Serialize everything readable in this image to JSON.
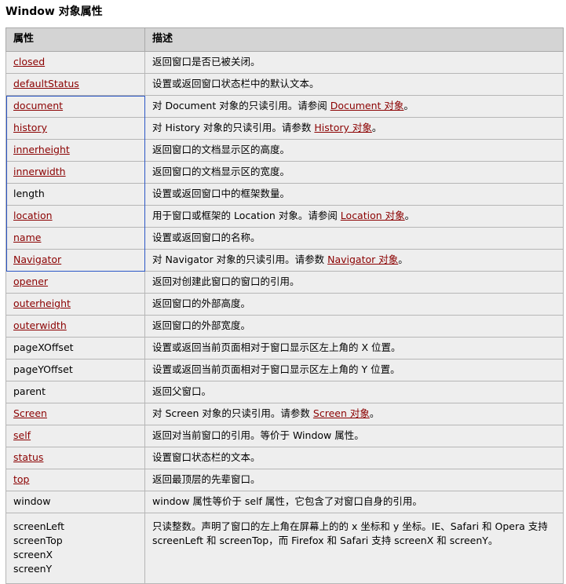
{
  "page": {
    "title": "Window 对象属性",
    "selection_color": "#2b56c6",
    "header_bg": "#d4d4d4",
    "row_bg": "#eeeeee",
    "link_color": "#8b0101"
  },
  "table": {
    "headers": {
      "property": "属性",
      "description": "描述"
    },
    "rows": [
      {
        "property": "closed",
        "property_is_link": true,
        "desc_parts": [
          {
            "text": "返回窗口是否已被关闭。",
            "link": false
          }
        ]
      },
      {
        "property": "defaultStatus",
        "property_is_link": true,
        "desc_parts": [
          {
            "text": "设置或返回窗口状态栏中的默认文本。",
            "link": false
          }
        ]
      },
      {
        "property": "document",
        "property_is_link": true,
        "desc_parts": [
          {
            "text": "对 Document 对象的只读引用。请参阅 ",
            "link": false
          },
          {
            "text": "Document 对象",
            "link": true
          },
          {
            "text": "。",
            "link": false
          }
        ]
      },
      {
        "property": "history",
        "property_is_link": true,
        "desc_parts": [
          {
            "text": "对 History 对象的只读引用。请参数 ",
            "link": false
          },
          {
            "text": "History 对象",
            "link": true
          },
          {
            "text": "。",
            "link": false
          }
        ]
      },
      {
        "property": "innerheight",
        "property_is_link": true,
        "desc_parts": [
          {
            "text": "返回窗口的文档显示区的高度。",
            "link": false
          }
        ]
      },
      {
        "property": "innerwidth",
        "property_is_link": true,
        "desc_parts": [
          {
            "text": "返回窗口的文档显示区的宽度。",
            "link": false
          }
        ]
      },
      {
        "property": "length",
        "property_is_link": false,
        "desc_parts": [
          {
            "text": "设置或返回窗口中的框架数量。",
            "link": false
          }
        ]
      },
      {
        "property": "location",
        "property_is_link": true,
        "desc_parts": [
          {
            "text": "用于窗口或框架的 Location 对象。请参阅 ",
            "link": false
          },
          {
            "text": "Location 对象",
            "link": true
          },
          {
            "text": "。",
            "link": false
          }
        ]
      },
      {
        "property": "name",
        "property_is_link": true,
        "desc_parts": [
          {
            "text": "设置或返回窗口的名称。",
            "link": false
          }
        ]
      },
      {
        "property": "Navigator",
        "property_is_link": true,
        "desc_parts": [
          {
            "text": "对 Navigator 对象的只读引用。请参数 ",
            "link": false
          },
          {
            "text": "Navigator 对象",
            "link": true
          },
          {
            "text": "。",
            "link": false
          }
        ]
      },
      {
        "property": "opener",
        "property_is_link": true,
        "desc_parts": [
          {
            "text": "返回对创建此窗口的窗口的引用。",
            "link": false
          }
        ]
      },
      {
        "property": "outerheight",
        "property_is_link": true,
        "desc_parts": [
          {
            "text": "返回窗口的外部高度。",
            "link": false
          }
        ]
      },
      {
        "property": "outerwidth",
        "property_is_link": true,
        "desc_parts": [
          {
            "text": "返回窗口的外部宽度。",
            "link": false
          }
        ]
      },
      {
        "property": "pageXOffset",
        "property_is_link": false,
        "desc_parts": [
          {
            "text": "设置或返回当前页面相对于窗口显示区左上角的 X 位置。",
            "link": false
          }
        ]
      },
      {
        "property": "pageYOffset",
        "property_is_link": false,
        "desc_parts": [
          {
            "text": "设置或返回当前页面相对于窗口显示区左上角的 Y 位置。",
            "link": false
          }
        ]
      },
      {
        "property": "parent",
        "property_is_link": false,
        "desc_parts": [
          {
            "text": "返回父窗口。",
            "link": false
          }
        ]
      },
      {
        "property": "Screen",
        "property_is_link": true,
        "desc_parts": [
          {
            "text": "对 Screen 对象的只读引用。请参数 ",
            "link": false
          },
          {
            "text": "Screen 对象",
            "link": true
          },
          {
            "text": "。",
            "link": false
          }
        ]
      },
      {
        "property": "self",
        "property_is_link": true,
        "desc_parts": [
          {
            "text": "返回对当前窗口的引用。等价于 Window 属性。",
            "link": false
          }
        ]
      },
      {
        "property": "status",
        "property_is_link": true,
        "desc_parts": [
          {
            "text": "设置窗口状态栏的文本。",
            "link": false
          }
        ]
      },
      {
        "property": "top",
        "property_is_link": true,
        "desc_parts": [
          {
            "text": "返回最顶层的先辈窗口。",
            "link": false
          }
        ]
      },
      {
        "property": "window",
        "property_is_link": false,
        "desc_parts": [
          {
            "text": "window 属性等价于 self 属性，它包含了对窗口自身的引用。",
            "link": false
          }
        ]
      },
      {
        "property": "screenLeft\nscreenTop\nscreenX\nscreenY",
        "property_is_link": false,
        "multiline": true,
        "desc_parts": [
          {
            "text": "只读整数。声明了窗口的左上角在屏幕上的的 x 坐标和 y 坐标。IE、Safari 和 Opera 支持 screenLeft 和 screenTop，而 Firefox 和 Safari 支持 screenX 和 screenY。",
            "link": false
          }
        ]
      }
    ],
    "selection": {
      "start_row_index": 2,
      "end_row_index": 9,
      "column": "property"
    }
  }
}
